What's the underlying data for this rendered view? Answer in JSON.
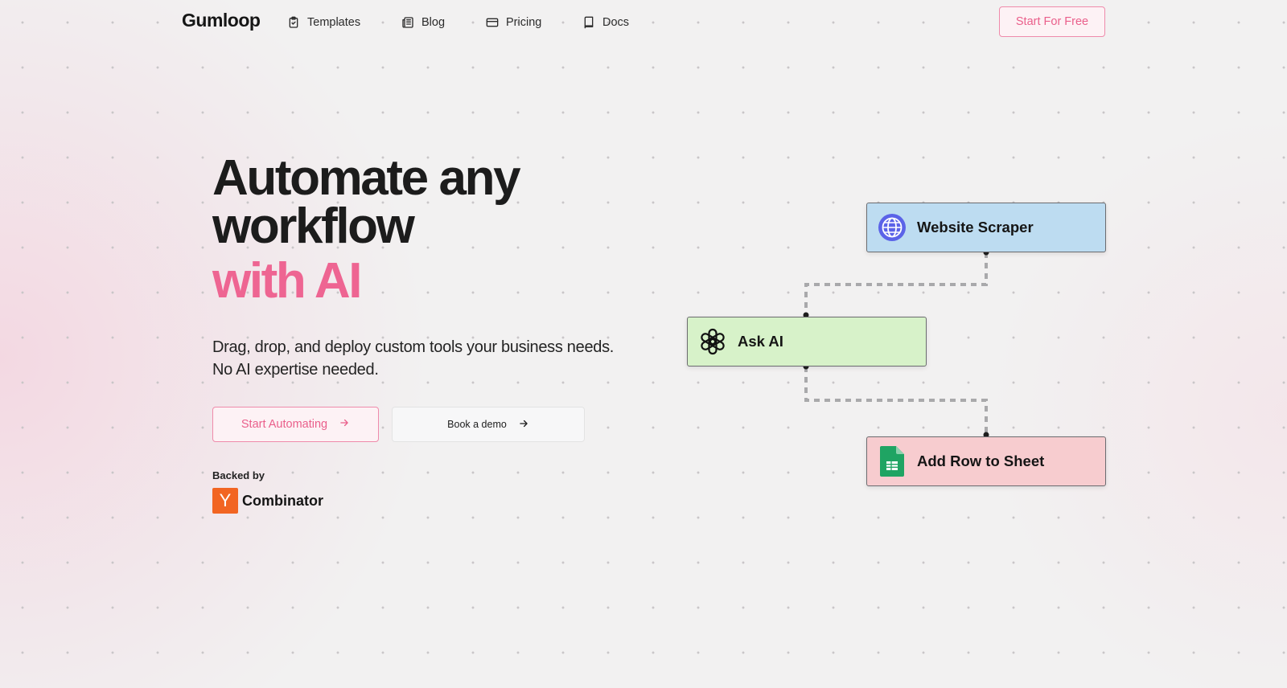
{
  "nav": {
    "logo": "Gumloop",
    "items": [
      {
        "label": "Templates",
        "icon": "clipboard-check-icon"
      },
      {
        "label": "Blog",
        "icon": "newspaper-icon"
      },
      {
        "label": "Pricing",
        "icon": "credit-card-icon"
      },
      {
        "label": "Docs",
        "icon": "book-icon"
      }
    ],
    "cta": "Start For Free"
  },
  "hero": {
    "title_line1": "Automate any",
    "title_line2": "workflow",
    "title_accent": "with AI",
    "subtitle_line1": "Drag, drop, and deploy custom tools your business needs.",
    "subtitle_line2": "No AI expertise needed.",
    "primary_button": "Start Automating",
    "secondary_button": "Book a demo",
    "backed_by": "Backed by",
    "backer_logo_letter": "Y",
    "backer_name": "Combinator"
  },
  "flow": {
    "nodes": [
      {
        "label": "Website Scraper",
        "icon": "globe-icon",
        "color": "#bddcf1"
      },
      {
        "label": "Ask AI",
        "icon": "openai-icon",
        "color": "#d7f2c9"
      },
      {
        "label": "Add Row to Sheet",
        "icon": "google-sheets-icon",
        "color": "#f7cccf"
      }
    ]
  },
  "colors": {
    "accent": "#ee6592",
    "background": "#f2f1f1",
    "yc_orange": "#f26522"
  }
}
